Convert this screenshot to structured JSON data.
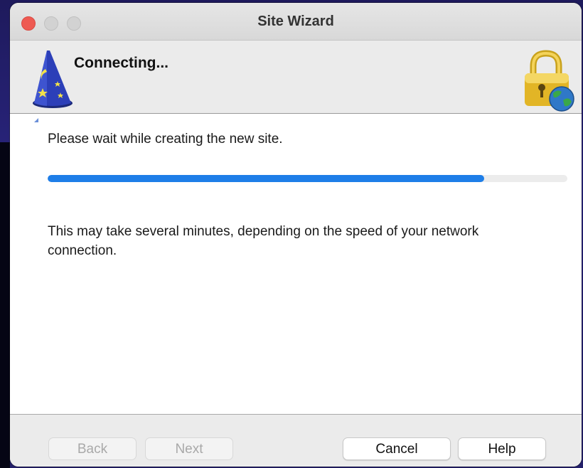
{
  "window": {
    "title": "Site Wizard"
  },
  "header": {
    "title": "Connecting...",
    "left_icon": "wizard-hat-icon",
    "right_icon": "lock-globe-icon"
  },
  "content": {
    "wait_message": "Please wait while creating the new site.",
    "progress_fraction": 0.84,
    "info_message": "This may take several minutes, depending on the speed of your network connection."
  },
  "footer": {
    "back_label": "Back",
    "next_label": "Next",
    "cancel_label": "Cancel",
    "help_label": "Help"
  },
  "colors": {
    "accent": "#1e7ee8",
    "close_button": "#ee5a52"
  }
}
